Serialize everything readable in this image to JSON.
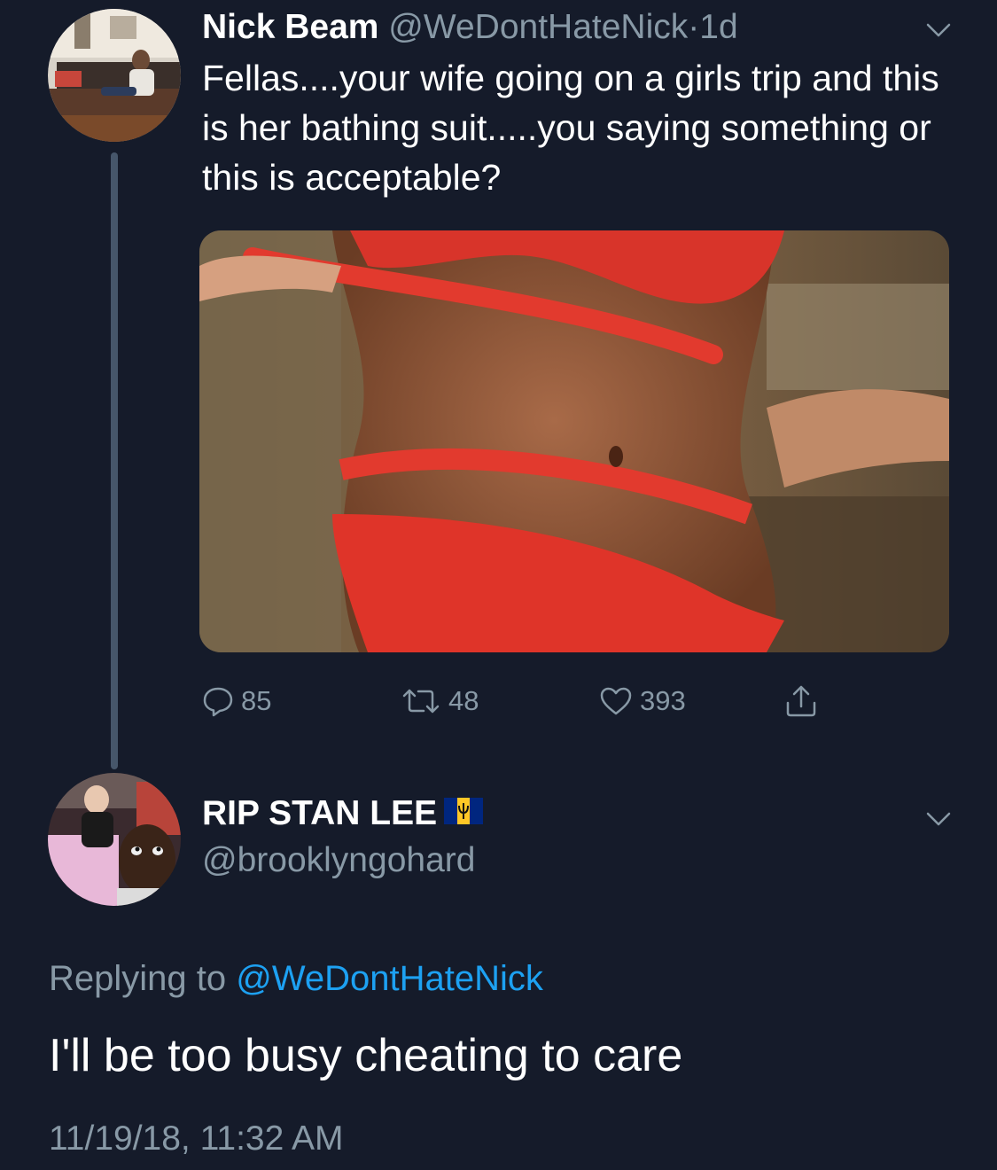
{
  "tweet": {
    "author_name": "Nick Beam",
    "author_handle": "@WeDontHateNick",
    "separator": "·",
    "time_ago": "1d",
    "text": "Fellas....your wife going on a girls trip and this is her bathing suit.....you saying something or this is acceptable?",
    "icons": {
      "reply": "reply-icon",
      "retweet": "retweet-icon",
      "like": "heart-icon",
      "share": "share-icon",
      "menu": "chevron-down-icon"
    },
    "stats": {
      "replies": "85",
      "retweets": "48",
      "likes": "393"
    }
  },
  "reply": {
    "author_name": "RIP STAN LEE",
    "author_handle": "@brooklyngohard",
    "flag": "barbados-flag-icon",
    "replying_prefix": "Replying to",
    "replying_to": "@WeDontHateNick",
    "text": "I'll be too busy cheating to care",
    "timestamp": "11/19/18, 11:32 AM"
  },
  "colors": {
    "background": "#151b2a",
    "muted_text": "#8899a6",
    "link": "#1da1f2",
    "thread_line": "#46566a"
  }
}
